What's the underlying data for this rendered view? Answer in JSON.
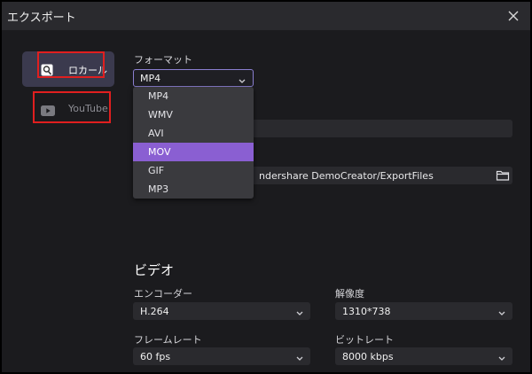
{
  "window": {
    "title": "エクスポート"
  },
  "sidebar": {
    "items": [
      {
        "label": "ロカール",
        "icon": "local-drive-icon",
        "active": true
      },
      {
        "label": "YouTube",
        "icon": "youtube-icon",
        "active": false
      }
    ]
  },
  "format": {
    "label": "フォーマット",
    "selected": "MP4",
    "options": [
      "MP4",
      "WMV",
      "AVI",
      "MOV",
      "GIF",
      "MP3"
    ],
    "highlighted": "MOV"
  },
  "save_path": {
    "value": "ndershare DemoCreator/ExportFiles",
    "icon": "folder-icon"
  },
  "video": {
    "section_title": "ビデオ",
    "encoder": {
      "label": "エンコーダー",
      "value": "H.264"
    },
    "resolution": {
      "label": "解像度",
      "value": "1310*738"
    },
    "frame_rate": {
      "label": "フレームレート",
      "value": "60 fps"
    },
    "bit_rate": {
      "label": "ビットレート",
      "value": "8000 kbps"
    }
  },
  "colors": {
    "accent": "#8a5fd2",
    "highlight_box": "#e01f1f",
    "background": "#1b1b1e"
  }
}
